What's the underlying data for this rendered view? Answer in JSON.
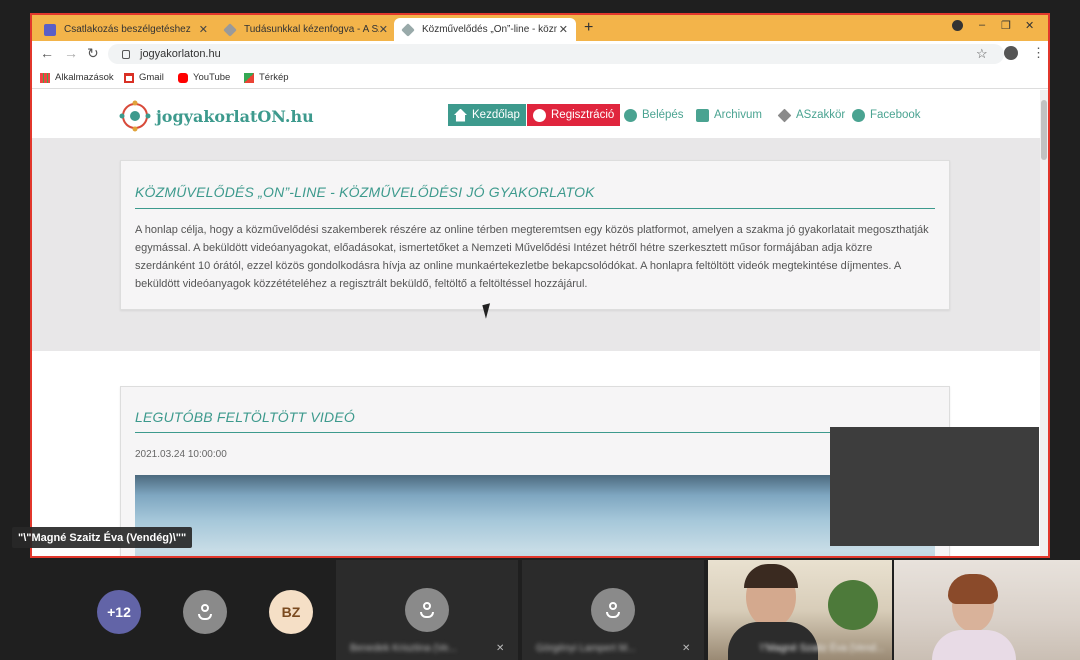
{
  "browser": {
    "tabs": [
      {
        "title": "Csatlakozás beszélgetéshez",
        "icon": "teams-icon"
      },
      {
        "title": "Tudásunkkal kézenfogva - A Szakkör",
        "icon": "diamond-icon"
      },
      {
        "title": "Közművelődés „On”-line - közművelődési",
        "icon": "diamond-icon"
      }
    ],
    "url": "jogyakorlaton.hu",
    "bookmarks": [
      {
        "label": "Alkalmazások",
        "icon": "apps-grid-icon"
      },
      {
        "label": "Gmail",
        "icon": "gmail-icon"
      },
      {
        "label": "YouTube",
        "icon": "youtube-icon"
      },
      {
        "label": "Térkép",
        "icon": "maps-icon"
      }
    ]
  },
  "site": {
    "logo": "jogyakorlatON.hu",
    "nav": [
      {
        "label": "Kezdőlap",
        "icon": "home-icon"
      },
      {
        "label": "Regisztráció",
        "icon": "user-check-icon"
      },
      {
        "label": "Belépés",
        "icon": "user-circle-icon"
      },
      {
        "label": "Archivum",
        "icon": "play-square-icon"
      },
      {
        "label": "ASzakkör",
        "icon": "diamond-icon"
      },
      {
        "label": "Facebook",
        "icon": "facebook-icon"
      }
    ],
    "intro": {
      "title": "KÖZMŰVELŐDÉS „ON”-LINE - KÖZMŰVELŐDÉSI JÓ GYAKORLATOK",
      "body": "A honlap célja, hogy a közművelődési szakemberek részére az online térben megteremtsen egy közös platformot, amelyen a szakma jó gyakorlatait megoszthatják egymással. A beküldött videóanyagokat, előadásokat, ismertetőket a Nemzeti Művelődési Intézet hétről hétre szerkesztett műsor formájában adja közre szerdánként 10 órától, ezzel közös gondolkodásra hívja az online munkaértekezletbe bekapcsolódókat. A honlapra feltöltött videók megtekintése díjmentes. A beküldött videóanyagok közzétételéhez a regisztrált beküldő, feltöltő a feltöltéssel hozzájárul."
    },
    "latest": {
      "title": "LEGUTÓBB FELTÖLTÖTT VIDEÓ",
      "date": "2021.03.24 10:00:00"
    }
  },
  "meeting": {
    "presenter_label": "\"\\\"Magné Szaitz Éva (Vendég)\\\"\"",
    "overflow_count": "+12",
    "initials": "BZ",
    "participants": [
      {
        "name": "Benedek Krisztina (Ve..."
      },
      {
        "name": "Görgényi Lampert M..."
      },
      {
        "name": "\\\"Magné Szaitz Éva (Vend..."
      }
    ]
  },
  "colors": {
    "accent": "#3d9a8d",
    "register": "#e0253d",
    "share_border": "#e2372c",
    "tabbar": "#f3b44a"
  }
}
